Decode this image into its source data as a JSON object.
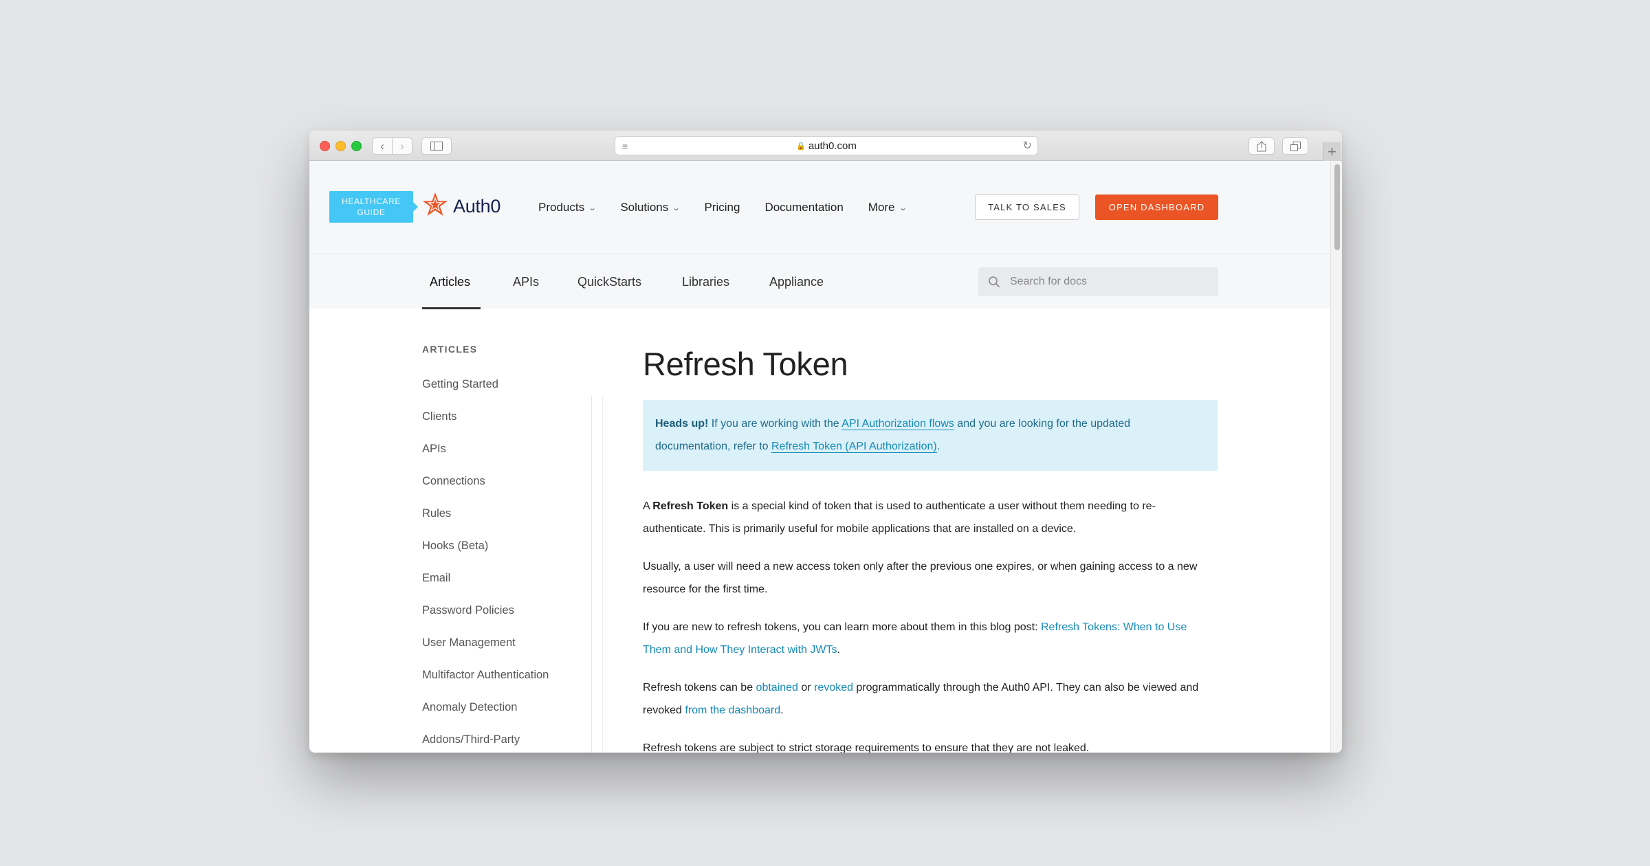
{
  "browser": {
    "url": "auth0.com"
  },
  "header": {
    "badge_line1": "HEALTHCARE",
    "badge_line2": "GUIDE",
    "logo_text": "Auth0",
    "nav": [
      {
        "label": "Products",
        "has_caret": true
      },
      {
        "label": "Solutions",
        "has_caret": true
      },
      {
        "label": "Pricing",
        "has_caret": false
      },
      {
        "label": "Documentation",
        "has_caret": false
      },
      {
        "label": "More",
        "has_caret": true
      }
    ],
    "talk_to_sales": "TALK TO SALES",
    "open_dashboard": "OPEN DASHBOARD",
    "brand_color": "#eb5424",
    "badge_color": "#44c7f4"
  },
  "subnav": {
    "tabs": [
      "Articles",
      "APIs",
      "QuickStarts",
      "Libraries",
      "Appliance"
    ],
    "active_tab": "Articles",
    "search_placeholder": "Search for docs"
  },
  "sidebar": {
    "title": "ARTICLES",
    "items": [
      "Getting Started",
      "Clients",
      "APIs",
      "Connections",
      "Rules",
      "Hooks (Beta)",
      "Email",
      "Password Policies",
      "User Management",
      "Multifactor Authentication",
      "Anomaly Detection",
      "Addons/Third-Party"
    ]
  },
  "article": {
    "title": "Refresh Token",
    "notice": {
      "heads_up": "Heads up!",
      "text1": " If you are working with the ",
      "link1": "API Authorization flows",
      "text2": " and you are looking for the updated documentation, refer to ",
      "link2": "Refresh Token (API Authorization)",
      "text3": "."
    },
    "p1": {
      "t1": "A ",
      "bold": "Refresh Token",
      "t2": " is a special kind of token that is used to authenticate a user without them needing to re-authenticate. This is primarily useful for mobile applications that are installed on a device."
    },
    "p2": "Usually, a user will need a new access token only after the previous one expires, or when gaining access to a new resource for the first time.",
    "p3": {
      "t1": "If you are new to refresh tokens, you can learn more about them in this blog post: ",
      "link": "Refresh Tokens: When to Use Them and How They Interact with JWTs",
      "t2": "."
    },
    "p4": {
      "t1": "Refresh tokens can be ",
      "link1": "obtained",
      "t2": " or ",
      "link2": "revoked",
      "t3": " programmatically through the Auth0 API. They can also be viewed and revoked ",
      "link3": "from the dashboard",
      "t4": "."
    },
    "p5": "Refresh tokens are subject to strict storage requirements to ensure that they are not leaked."
  }
}
